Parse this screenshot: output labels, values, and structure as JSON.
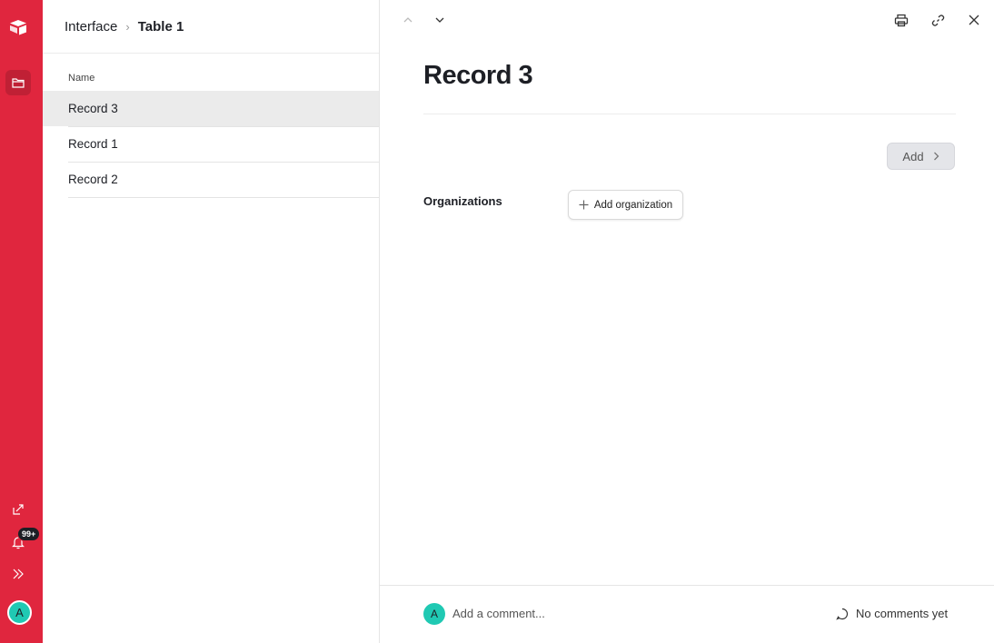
{
  "breadcrumb": {
    "root": "Interface",
    "current": "Table 1"
  },
  "list": {
    "column_header": "Name",
    "rows": [
      {
        "label": "Record 3",
        "selected": true
      },
      {
        "label": "Record 1",
        "selected": false
      },
      {
        "label": "Record 2",
        "selected": false
      }
    ]
  },
  "rail": {
    "notification_count": "99+",
    "avatar_initial": "A",
    "accent_color": "#e0263e"
  },
  "detail": {
    "title": "Record 3",
    "add_button_label": "Add",
    "field_label": "Organizations",
    "add_org_label": "Add organization",
    "comment_avatar_initial": "A",
    "comment_placeholder": "Add a comment...",
    "no_comments_label": "No comments yet"
  }
}
